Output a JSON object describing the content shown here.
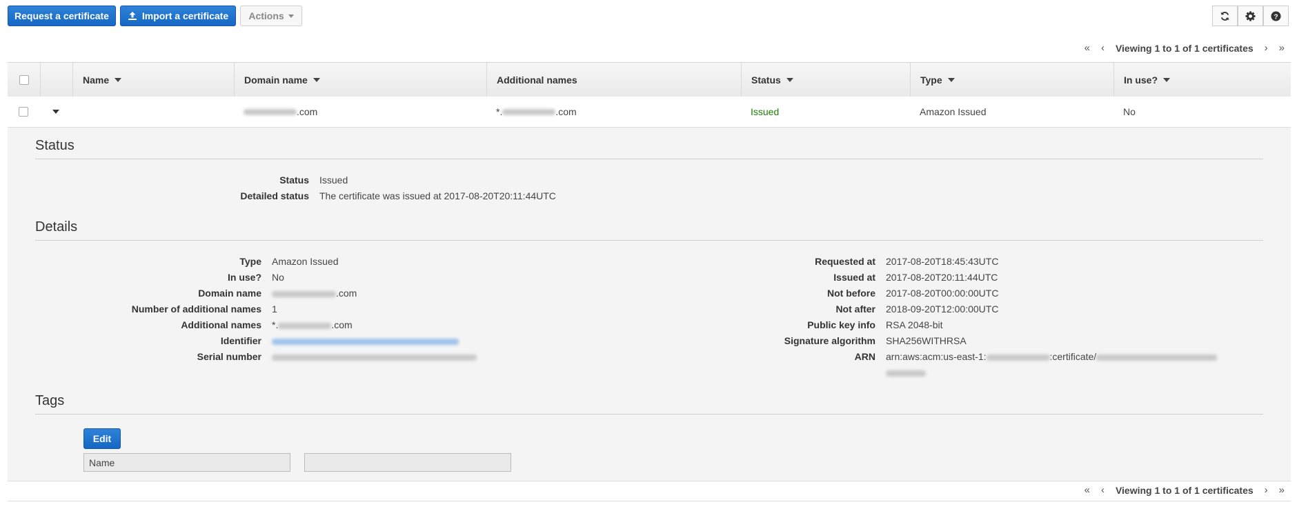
{
  "toolbar": {
    "request_label": "Request a certificate",
    "import_label": "Import a certificate",
    "actions_label": "Actions",
    "refresh_icon": "refresh-icon",
    "settings_icon": "gear-icon",
    "help_icon": "help-icon"
  },
  "pager": {
    "text": "Viewing 1 to 1 of 1 certificates",
    "first": "«",
    "prev": "‹",
    "next": "›",
    "last": "»"
  },
  "table": {
    "columns": [
      "Name",
      "Domain name",
      "Additional names",
      "Status",
      "Type",
      "In use?"
    ],
    "row": {
      "name": "",
      "domain_suffix": ".com",
      "additional_prefix": "*.",
      "additional_suffix": ".com",
      "status": "Issued",
      "type": "Amazon Issued",
      "in_use": "No"
    }
  },
  "status_section": {
    "title": "Status",
    "status_label": "Status",
    "status_value": "Issued",
    "detailed_label": "Detailed status",
    "detailed_value": "The certificate was issued at 2017-08-20T20:11:44UTC"
  },
  "details_section": {
    "title": "Details",
    "left": {
      "type_label": "Type",
      "type_value": "Amazon Issued",
      "in_use_label": "In use?",
      "in_use_value": "No",
      "domain_label": "Domain name",
      "domain_suffix": ".com",
      "num_additional_label": "Number of additional names",
      "num_additional_value": "1",
      "additional_label": "Additional names",
      "additional_prefix": "*.",
      "additional_suffix": ".com",
      "identifier_label": "Identifier",
      "serial_label": "Serial number"
    },
    "right": {
      "requested_label": "Requested at",
      "requested_value": "2017-08-20T18:45:43UTC",
      "issued_label": "Issued at",
      "issued_value": "2017-08-20T20:11:44UTC",
      "not_before_label": "Not before",
      "not_before_value": "2017-08-20T00:00:00UTC",
      "not_after_label": "Not after",
      "not_after_value": "2018-09-20T12:00:00UTC",
      "public_key_label": "Public key info",
      "public_key_value": "RSA 2048-bit",
      "sig_label": "Signature algorithm",
      "sig_value": "SHA256WITHRSA",
      "arn_label": "ARN",
      "arn_prefix": "arn:aws:acm:us-east-1:",
      "arn_middle": ":certificate/"
    }
  },
  "tags_section": {
    "title": "Tags",
    "edit_label": "Edit",
    "name_value": "Name",
    "value_value": ""
  },
  "colors": {
    "primary": "#1f74cf",
    "status_issued": "#1d8102"
  }
}
